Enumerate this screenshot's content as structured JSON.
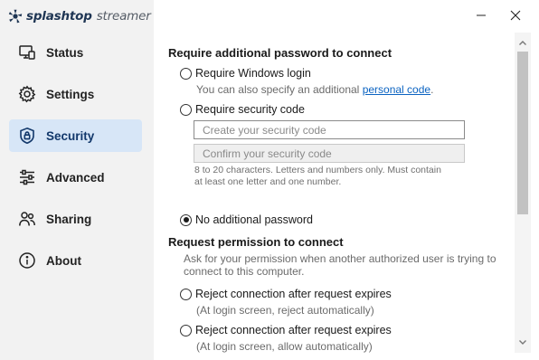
{
  "app": {
    "brand": "splashtop",
    "product": "streamer"
  },
  "window": {
    "minimize_icon": "minimize-icon",
    "close_icon": "close-icon"
  },
  "sidebar": {
    "items": [
      {
        "label": "Status",
        "icon": "monitor-icon",
        "active": false
      },
      {
        "label": "Settings",
        "icon": "gear-icon",
        "active": false
      },
      {
        "label": "Security",
        "icon": "shield-lock-icon",
        "active": true
      },
      {
        "label": "Advanced",
        "icon": "sliders-icon",
        "active": false
      },
      {
        "label": "Sharing",
        "icon": "users-icon",
        "active": false
      },
      {
        "label": "About",
        "icon": "info-icon",
        "active": false
      }
    ]
  },
  "password_section": {
    "title": "Require additional password to connect",
    "windows_login": {
      "label": "Require Windows login",
      "checked": false
    },
    "windows_hint_prefix": "You can also specify an additional ",
    "windows_hint_link": "personal code",
    "windows_hint_suffix": ".",
    "security_code": {
      "label": "Require security code",
      "checked": false
    },
    "create_placeholder": "Create your security code",
    "confirm_placeholder": "Confirm your security code",
    "code_rules_line1": "8 to 20 characters. Letters and numbers only. Must contain",
    "code_rules_line2": "at least one letter and one number.",
    "no_password": {
      "label": "No additional password",
      "checked": true
    }
  },
  "permission_section": {
    "title": "Request permission to connect",
    "desc_line1": "Ask for your permission when another authorized user is trying to",
    "desc_line2": "connect to this computer.",
    "option1": {
      "label": "Reject connection after request expires",
      "hint": "(At login screen, reject automatically)",
      "checked": false
    },
    "option2": {
      "label": "Reject connection after request expires",
      "hint": "(At login screen, allow automatically)",
      "checked": false
    }
  },
  "colors": {
    "accent": "#0b63c1",
    "active_bg": "#d7e6f7",
    "brand_navy": "#1e3553",
    "sidebar_bg": "#f2f2f2"
  }
}
